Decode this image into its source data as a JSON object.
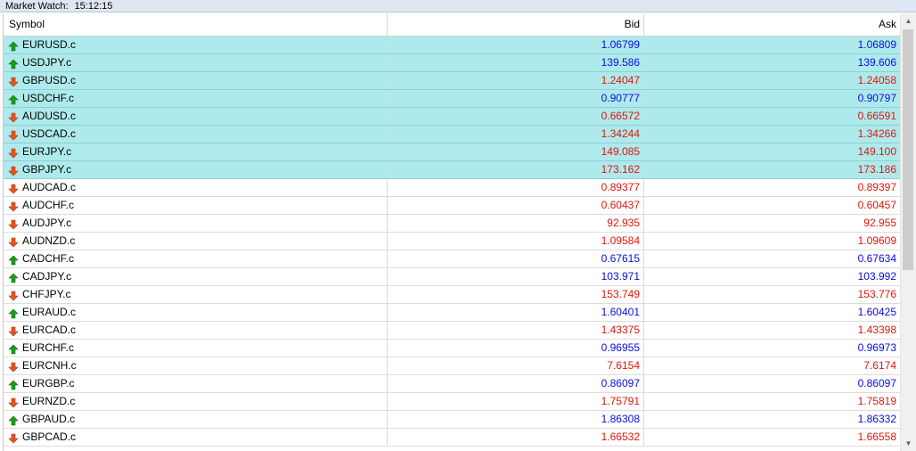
{
  "window": {
    "title": "Market Watch:",
    "time": "15:12:15"
  },
  "columns": {
    "symbol": "Symbol",
    "bid": "Bid",
    "ask": "Ask"
  },
  "colors": {
    "up": "#0b0be0",
    "down": "#e0150b",
    "selected_row": "#aeeaec"
  },
  "rows": [
    {
      "symbol": "EURUSD.c",
      "bid": "1.06799",
      "ask": "1.06809",
      "dir": "up",
      "selected": true
    },
    {
      "symbol": "USDJPY.c",
      "bid": "139.586",
      "ask": "139.606",
      "dir": "up",
      "selected": true
    },
    {
      "symbol": "GBPUSD.c",
      "bid": "1.24047",
      "ask": "1.24058",
      "dir": "down",
      "selected": true
    },
    {
      "symbol": "USDCHF.c",
      "bid": "0.90777",
      "ask": "0.90797",
      "dir": "up",
      "selected": true
    },
    {
      "symbol": "AUDUSD.c",
      "bid": "0.66572",
      "ask": "0.66591",
      "dir": "down",
      "selected": true
    },
    {
      "symbol": "USDCAD.c",
      "bid": "1.34244",
      "ask": "1.34266",
      "dir": "down",
      "selected": true
    },
    {
      "symbol": "EURJPY.c",
      "bid": "149.085",
      "ask": "149.100",
      "dir": "down",
      "selected": true
    },
    {
      "symbol": "GBPJPY.c",
      "bid": "173.162",
      "ask": "173.186",
      "dir": "down",
      "selected": true
    },
    {
      "symbol": "AUDCAD.c",
      "bid": "0.89377",
      "ask": "0.89397",
      "dir": "down",
      "selected": false
    },
    {
      "symbol": "AUDCHF.c",
      "bid": "0.60437",
      "ask": "0.60457",
      "dir": "down",
      "selected": false
    },
    {
      "symbol": "AUDJPY.c",
      "bid": "92.935",
      "ask": "92.955",
      "dir": "down",
      "selected": false
    },
    {
      "symbol": "AUDNZD.c",
      "bid": "1.09584",
      "ask": "1.09609",
      "dir": "down",
      "selected": false
    },
    {
      "symbol": "CADCHF.c",
      "bid": "0.67615",
      "ask": "0.67634",
      "dir": "up",
      "selected": false
    },
    {
      "symbol": "CADJPY.c",
      "bid": "103.971",
      "ask": "103.992",
      "dir": "up",
      "selected": false
    },
    {
      "symbol": "CHFJPY.c",
      "bid": "153.749",
      "ask": "153.776",
      "dir": "down",
      "selected": false
    },
    {
      "symbol": "EURAUD.c",
      "bid": "1.60401",
      "ask": "1.60425",
      "dir": "up",
      "selected": false
    },
    {
      "symbol": "EURCAD.c",
      "bid": "1.43375",
      "ask": "1.43398",
      "dir": "down",
      "selected": false
    },
    {
      "symbol": "EURCHF.c",
      "bid": "0.96955",
      "ask": "0.96973",
      "dir": "up",
      "selected": false
    },
    {
      "symbol": "EURCNH.c",
      "bid": "7.6154",
      "ask": "7.6174",
      "dir": "down",
      "selected": false
    },
    {
      "symbol": "EURGBP.c",
      "bid": "0.86097",
      "ask": "0.86097",
      "dir": "up",
      "selected": false
    },
    {
      "symbol": "EURNZD.c",
      "bid": "1.75791",
      "ask": "1.75819",
      "dir": "down",
      "selected": false
    },
    {
      "symbol": "GBPAUD.c",
      "bid": "1.86308",
      "ask": "1.86332",
      "dir": "up",
      "selected": false
    },
    {
      "symbol": "GBPCAD.c",
      "bid": "1.66532",
      "ask": "1.66558",
      "dir": "down",
      "selected": false
    }
  ]
}
